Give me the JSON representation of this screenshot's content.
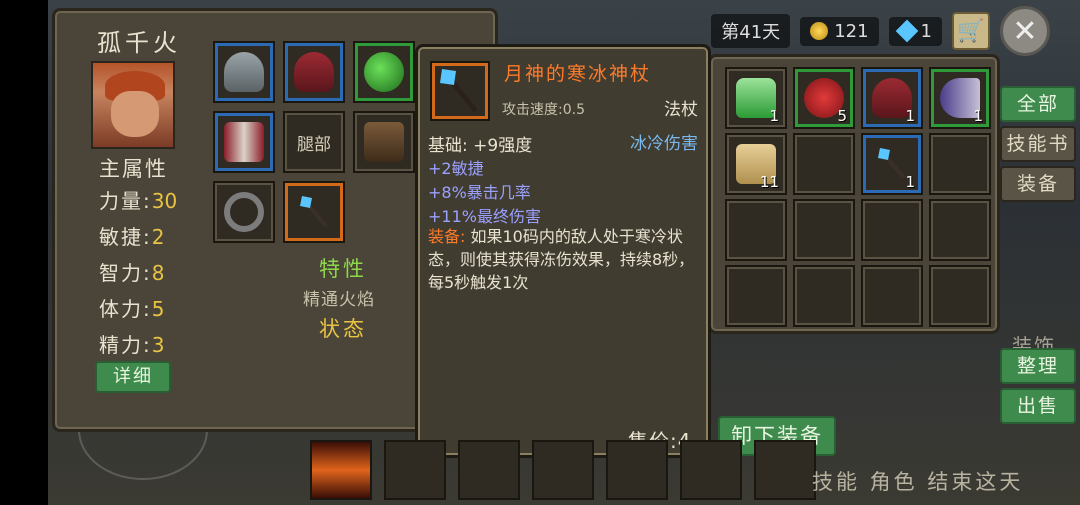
{
  "topbar": {
    "day": "第41天",
    "gold": "121",
    "gems": "1"
  },
  "character": {
    "name": "孤千火",
    "attr_title": "主属性",
    "stats": [
      {
        "label": "力量:",
        "value": "30"
      },
      {
        "label": "敏捷:",
        "value": "2"
      },
      {
        "label": "智力:",
        "value": "8"
      },
      {
        "label": "体力:",
        "value": "5"
      },
      {
        "label": "精力:",
        "value": "3"
      }
    ],
    "detail_btn": "详细",
    "legs_label": "腿部",
    "trait": "特性",
    "trait_sub": "精通火焰",
    "state": "状态"
  },
  "tooltip": {
    "name": "月神的寒冰神杖",
    "speed": "攻击速度:0.5",
    "type": "法杖",
    "base": "基础: +9强度",
    "damage": "冰冷伤害",
    "bonuses": [
      "+2敏捷",
      "+8%暴击几率",
      "+11%最终伤害"
    ],
    "equip_label": "装备:",
    "equip_text": "如果10码内的敌人处于寒冷状态，则使其获得冻伤效果，持续8秒，每5秒触发1次",
    "price": "售价:4",
    "unequip": "卸下装备"
  },
  "bag_counts": {
    "potion_green": "1",
    "potion_red": "5",
    "helmet": "1",
    "shield": "1",
    "scroll": "11",
    "staff": "1"
  },
  "side_tabs": {
    "all": "全部",
    "skillbook": "技能书",
    "equip": "装备",
    "sort": "整理",
    "sell": "出售"
  },
  "deco_text": "装饰",
  "bottom_text": "技能 角色 结束这天"
}
